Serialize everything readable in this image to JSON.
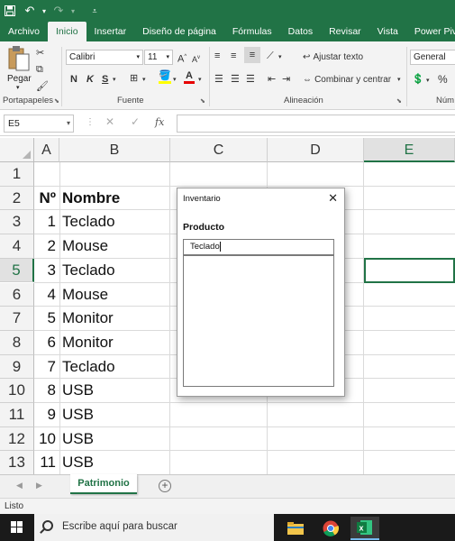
{
  "ribbon": {
    "tabs": [
      {
        "label": "Archivo"
      },
      {
        "label": "Inicio"
      },
      {
        "label": "Insertar"
      },
      {
        "label": "Diseño de página"
      },
      {
        "label": "Fórmulas"
      },
      {
        "label": "Datos"
      },
      {
        "label": "Revisar"
      },
      {
        "label": "Vista"
      },
      {
        "label": "Power Pivot"
      }
    ],
    "font_name": "Calibri",
    "font_size": "11",
    "bold_label": "N",
    "italic_label": "K",
    "underline_label": "S",
    "paste_label": "Pegar",
    "wrap_text_label": "Ajustar texto",
    "merge_label": "Combinar y centrar",
    "number_format": "General",
    "percent_label": "%",
    "groups": {
      "clipboard": "Portapapeles",
      "font": "Fuente",
      "alignment": "Alineación",
      "number": "Núm"
    }
  },
  "formula_bar": {
    "name_box": "E5",
    "fx_label": "fx",
    "value": ""
  },
  "sheet": {
    "columns": [
      "A",
      "B",
      "C",
      "D",
      "E"
    ],
    "selected_column": "E",
    "selected_row": "5",
    "rows": [
      {
        "num": "1",
        "a": "",
        "b": ""
      },
      {
        "num": "2",
        "a": "Nº",
        "b": "Nombre"
      },
      {
        "num": "3",
        "a": "1",
        "b": "Teclado"
      },
      {
        "num": "4",
        "a": "2",
        "b": "Mouse"
      },
      {
        "num": "5",
        "a": "3",
        "b": "Teclado"
      },
      {
        "num": "6",
        "a": "4",
        "b": "Mouse"
      },
      {
        "num": "7",
        "a": "5",
        "b": "Monitor"
      },
      {
        "num": "8",
        "a": "6",
        "b": "Monitor"
      },
      {
        "num": "9",
        "a": "7",
        "b": "Teclado"
      },
      {
        "num": "10",
        "a": "8",
        "b": "USB"
      },
      {
        "num": "11",
        "a": "9",
        "b": "USB"
      },
      {
        "num": "12",
        "a": "10",
        "b": "USB"
      },
      {
        "num": "13",
        "a": "11",
        "b": "USB"
      }
    ]
  },
  "dialog": {
    "title": "Inventario",
    "close_label": "✕",
    "field_label": "Producto",
    "field_value": "Teclado"
  },
  "sheet_tabs": {
    "active": "Patrimonio",
    "add_label": "+"
  },
  "status": {
    "text": "Listo"
  },
  "taskbar": {
    "search_placeholder": "Escribe aquí para buscar"
  },
  "colors": {
    "accent": "#217346",
    "taskbar": "#1a1a1a"
  }
}
